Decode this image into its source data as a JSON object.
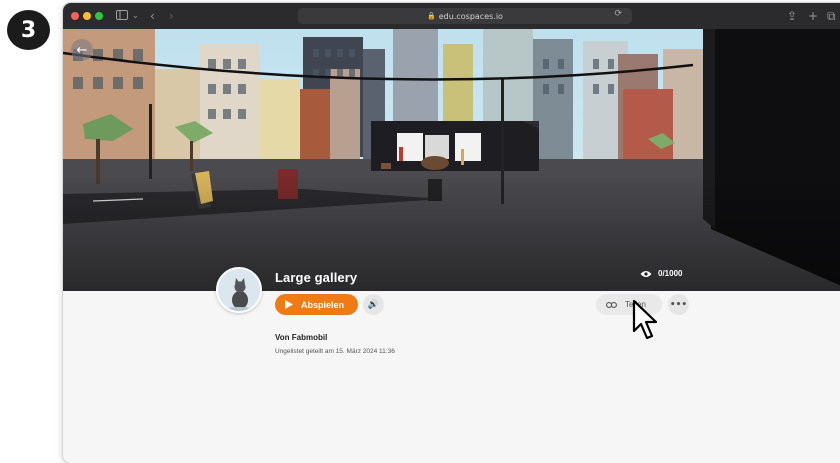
{
  "step": {
    "number": "3"
  },
  "browser": {
    "url": "edu.cospaces.io"
  },
  "space": {
    "title": "Large gallery",
    "views": "0/1000",
    "play_label": "Abspielen",
    "share_label": "Teilen",
    "author": "Von Fabmobil",
    "shared_info": "Ungelistet geteilt am 15. März 2024 11:36"
  },
  "colors": {
    "accent": "#f07b14",
    "titlebar": "#2b2b2d"
  },
  "icons": [
    "back-arrow-icon",
    "eye-icon",
    "play-icon",
    "speaker-icon",
    "link-icon",
    "more-icon",
    "lock-icon",
    "reload-icon",
    "share-icon",
    "plus-icon",
    "tabs-icon",
    "sidebar-icon",
    "cursor-icon"
  ]
}
